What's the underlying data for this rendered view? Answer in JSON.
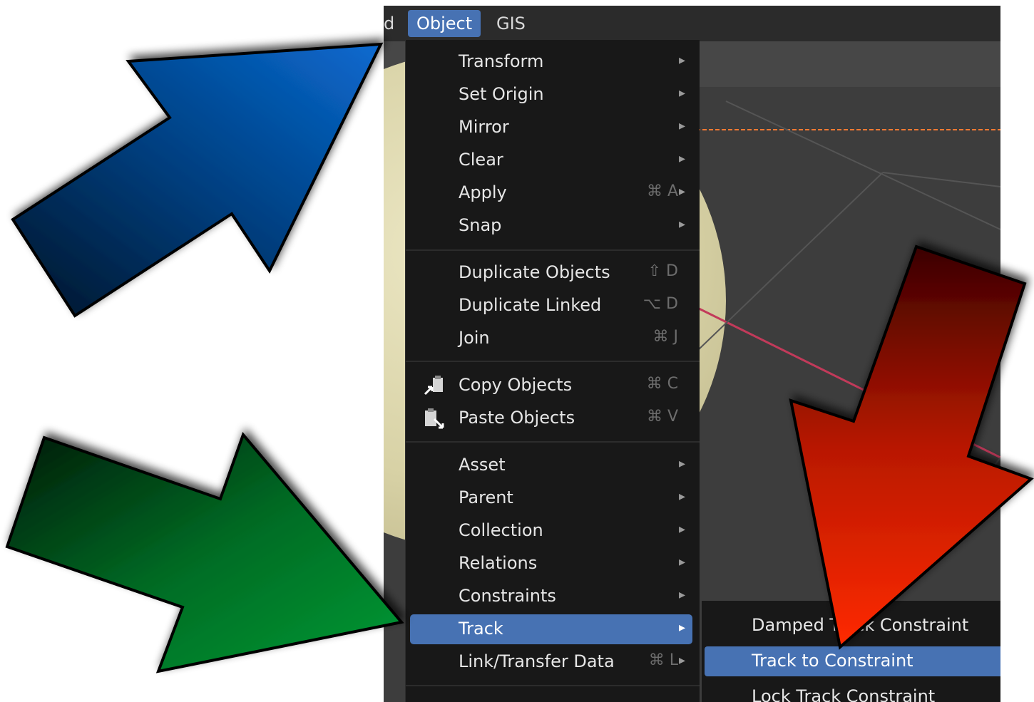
{
  "topbar": {
    "prev_item_fragment": "d",
    "object_label": "Object",
    "gis_label": "GIS"
  },
  "object_menu": {
    "items": [
      {
        "label": "Transform",
        "shortcut": "",
        "submenu": true
      },
      {
        "label": "Set Origin",
        "shortcut": "",
        "submenu": true
      },
      {
        "label": "Mirror",
        "shortcut": "",
        "submenu": true
      },
      {
        "label": "Clear",
        "shortcut": "",
        "submenu": true
      },
      {
        "label": "Apply",
        "shortcut": "⌘ A",
        "submenu": true
      },
      {
        "label": "Snap",
        "shortcut": "",
        "submenu": true
      },
      {
        "label": "Duplicate Objects",
        "shortcut": "⇧ D",
        "submenu": false
      },
      {
        "label": "Duplicate Linked",
        "shortcut": "⌥ D",
        "submenu": false
      },
      {
        "label": "Join",
        "shortcut": "⌘ J",
        "submenu": false
      },
      {
        "label": "Copy Objects",
        "shortcut": "⌘ C",
        "submenu": false,
        "icon": "copy-icon"
      },
      {
        "label": "Paste Objects",
        "shortcut": "⌘ V",
        "submenu": false,
        "icon": "paste-icon"
      },
      {
        "label": "Asset",
        "shortcut": "",
        "submenu": true
      },
      {
        "label": "Parent",
        "shortcut": "",
        "submenu": true
      },
      {
        "label": "Collection",
        "shortcut": "",
        "submenu": true
      },
      {
        "label": "Relations",
        "shortcut": "",
        "submenu": true
      },
      {
        "label": "Constraints",
        "shortcut": "",
        "submenu": true
      },
      {
        "label": "Track",
        "shortcut": "",
        "submenu": true,
        "highlighted": true
      },
      {
        "label": "Link/Transfer Data",
        "shortcut": "⌘ L",
        "submenu": true
      }
    ],
    "arrow_glyph": "▸"
  },
  "track_submenu": {
    "items": [
      {
        "label": "Damped Track Constraint"
      },
      {
        "label": "Track to Constraint",
        "highlighted": true
      },
      {
        "label": "Lock Track Constraint"
      }
    ]
  },
  "colors": {
    "menu_bg": "#181818",
    "highlight": "#4772b3",
    "arrow_blue": "#0a66c2",
    "arrow_green": "#008a2e",
    "arrow_red": "#ff2a00"
  },
  "annotations": [
    "blue-arrow-icon",
    "green-arrow-icon",
    "red-arrow-icon"
  ]
}
